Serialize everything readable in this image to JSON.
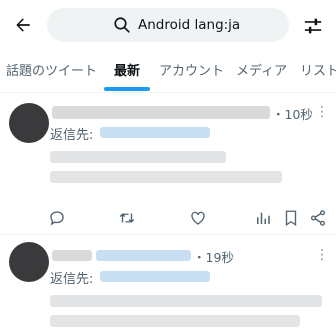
{
  "search": {
    "query": "Android lang:ja"
  },
  "tabs": [
    {
      "label": "話題のツイート",
      "active": false
    },
    {
      "label": "最新",
      "active": true
    },
    {
      "label": "アカウント",
      "active": false
    },
    {
      "label": "メディア",
      "active": false
    },
    {
      "label": "リスト",
      "active": false
    }
  ],
  "posts": [
    {
      "time": "・10秒",
      "reply_label": "返信先:",
      "more": "⋮"
    },
    {
      "time": "・19秒",
      "reply_label": "返信先:",
      "more": "⋮"
    }
  ],
  "colors": {
    "accent": "#1d9bf0",
    "text": "#0f1419",
    "muted": "#536471",
    "search_bg": "#eff3f4"
  }
}
